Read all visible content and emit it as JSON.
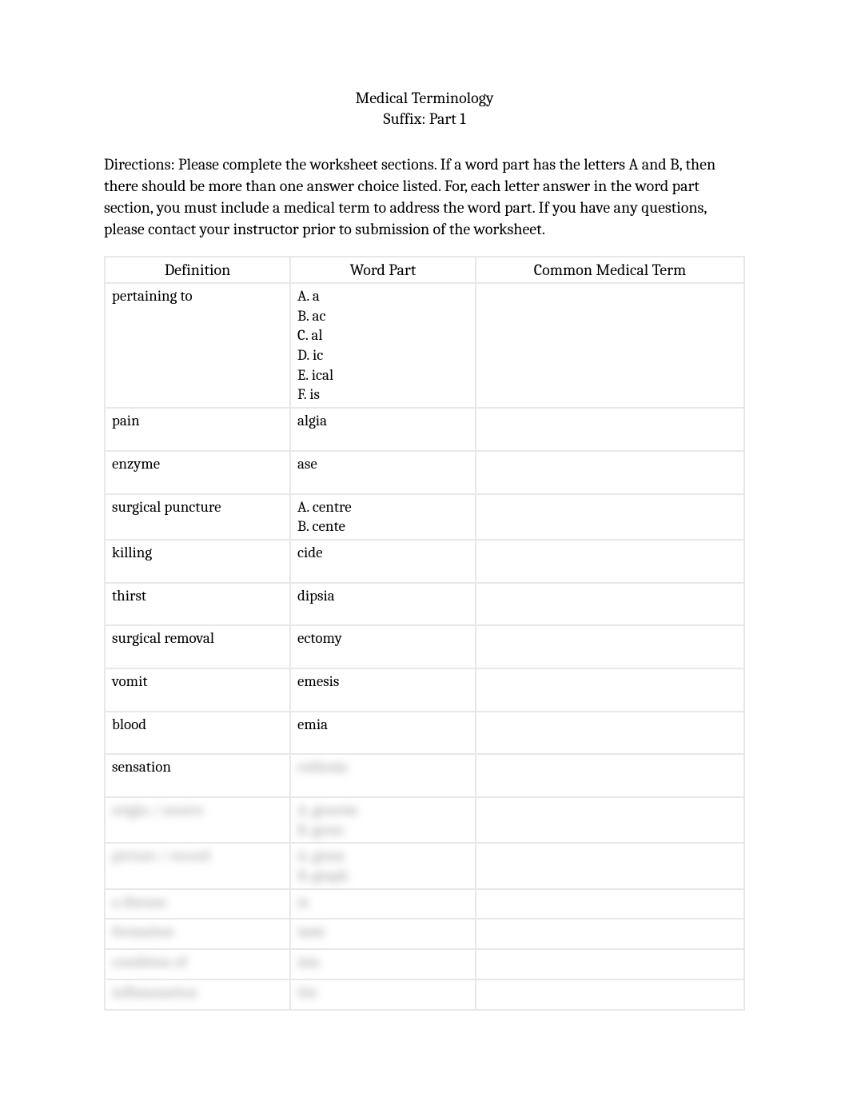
{
  "title": {
    "line1": "Medical Terminology",
    "line2": "Suffix: Part 1"
  },
  "directions": "Directions: Please complete the worksheet sections. If a word part has the letters A and B, then there should be more than one answer choice listed. For, each letter answer in the word part section, you must include a medical term to address the word part. If you have any questions, please contact your instructor prior to submission of the worksheet.",
  "headers": {
    "definition": "Definition",
    "wordpart": "Word Part",
    "term": "Common Medical Term"
  },
  "rows": [
    {
      "definition": "pertaining to",
      "wordpart": [
        "A. a",
        "B. ac",
        "C. al",
        "D. ic",
        "E. ical",
        "F. is"
      ],
      "term": "",
      "blurred": false,
      "tall": false
    },
    {
      "definition": "pain",
      "wordpart": [
        "algia"
      ],
      "term": "",
      "blurred": false,
      "tall": true
    },
    {
      "definition": "enzyme",
      "wordpart": [
        "ase"
      ],
      "term": "",
      "blurred": false,
      "tall": true
    },
    {
      "definition": "surgical puncture",
      "wordpart": [
        "A. centre",
        "B. cente"
      ],
      "term": "",
      "blurred": false,
      "tall": false
    },
    {
      "definition": "killing",
      "wordpart": [
        "cide"
      ],
      "term": "",
      "blurred": false,
      "tall": true
    },
    {
      "definition": "thirst",
      "wordpart": [
        "dipsia"
      ],
      "term": "",
      "blurred": false,
      "tall": true
    },
    {
      "definition": "surgical removal",
      "wordpart": [
        "ectomy"
      ],
      "term": "",
      "blurred": false,
      "tall": true
    },
    {
      "definition": "vomit",
      "wordpart": [
        "emesis"
      ],
      "term": "",
      "blurred": false,
      "tall": true
    },
    {
      "definition": "blood",
      "wordpart": [
        "emia"
      ],
      "term": "",
      "blurred": false,
      "tall": true
    },
    {
      "definition": "sensation",
      "wordpart": [
        "esthesia"
      ],
      "term": "",
      "blurred": false,
      "blurred_wp": true,
      "tall": true
    },
    {
      "definition": "origin / source",
      "wordpart": [
        "A. genesis",
        "B. genic"
      ],
      "term": "",
      "blurred": true,
      "tall": false
    },
    {
      "definition": "picture / record",
      "wordpart": [
        "A. gram",
        "B. graph"
      ],
      "term": "",
      "blurred": true,
      "tall": false
    },
    {
      "definition": "a disease",
      "wordpart": [
        "ia"
      ],
      "term": "",
      "blurred": true,
      "tall": false,
      "short": true
    },
    {
      "definition": "formation",
      "wordpart": [
        "iasis"
      ],
      "term": "",
      "blurred": true,
      "tall": false,
      "short": true
    },
    {
      "definition": "condition of",
      "wordpart": [
        "ism"
      ],
      "term": "",
      "blurred": true,
      "tall": false,
      "short": true
    },
    {
      "definition": "inflammation",
      "wordpart": [
        "itis"
      ],
      "term": "",
      "blurred": true,
      "tall": false,
      "short": true
    }
  ]
}
